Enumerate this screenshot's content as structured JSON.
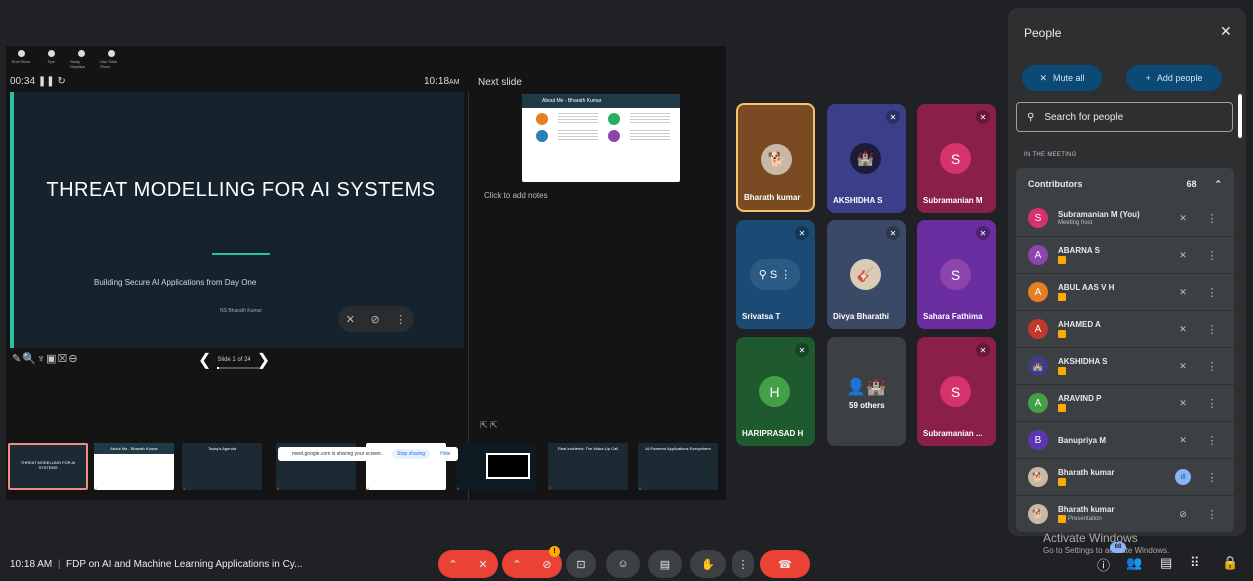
{
  "presenter": {
    "toolbar": [
      "End Show",
      "Tips",
      "Swap Displays",
      "Use Slide Show"
    ],
    "timer": "00:34",
    "clock": "10:18",
    "clock_ampm": "AM",
    "next_slide_label": "Next slide",
    "add_notes": "Click to add notes",
    "slide_counter": "Slide 1 of 24",
    "progress": 0.04
  },
  "current_slide": {
    "title": "THREAT MODELLING FOR AI SYSTEMS",
    "subtitle": "Building Secure AI Applications from Day One",
    "author": "NS Bharath Kumar"
  },
  "next_slide": {
    "title": "About Me - Bharath Kumar"
  },
  "thumbnails": [
    {
      "num": "1",
      "title": "THREAT MODELLING FOR AI SYSTEMS"
    },
    {
      "num": "2",
      "title": "About Me - Bharath Kumar"
    },
    {
      "num": "3",
      "title": "Today's Agenda"
    },
    {
      "num": "4",
      "title": ""
    },
    {
      "num": "5",
      "title": ""
    },
    {
      "num": "6",
      "title": ""
    },
    {
      "num": "7",
      "title": "Real Incidents: The Wake-Up Call"
    },
    {
      "num": "8",
      "title": "AI-Powered Applications Everywhere"
    }
  ],
  "share_banner": {
    "text": "meet.google.com is sharing your screen.",
    "stop": "Stop sharing",
    "hide": "Hide"
  },
  "tiles": [
    {
      "name": "Bharath kumar",
      "initial": "",
      "color": "#7a4a22"
    },
    {
      "name": "AKSHIDHA S",
      "initial": "",
      "color": "#3b3f8a"
    },
    {
      "name": "Subramanian M",
      "initial": "S",
      "color": "#8a1f4a"
    },
    {
      "name": "Srivatsa T",
      "initial": "",
      "color": "#1b4a74"
    },
    {
      "name": "Divya Bharathi",
      "initial": "",
      "color": "#3a4a66"
    },
    {
      "name": "Sahara Fathima",
      "initial": "S",
      "color": "#6a2ea0"
    },
    {
      "name": "HARIPRASAD H",
      "initial": "H",
      "color": "#1f5a2e"
    },
    {
      "name": "59 others",
      "initial": "",
      "color": "#3c4043"
    },
    {
      "name": "Subramanian ...",
      "initial": "S",
      "color": "#8a1f4a"
    }
  ],
  "people_panel": {
    "title": "People",
    "mute_all": "Mute all",
    "add_people": "Add people",
    "search_placeholder": "Search for people",
    "section": "IN THE MEETING",
    "group": "Contributors",
    "count": "68",
    "rows": [
      {
        "name": "Subramanian M (You)",
        "sub": "Meeting host",
        "initial": "S",
        "color": "#d6336c",
        "badge": false
      },
      {
        "name": "ABARNA S",
        "sub": "",
        "initial": "A",
        "color": "#8e44ad",
        "badge": true
      },
      {
        "name": "ABUL AAS V H",
        "sub": "",
        "initial": "A",
        "color": "#e67e22",
        "badge": true
      },
      {
        "name": "AHAMED A",
        "sub": "",
        "initial": "A",
        "color": "#c0392b",
        "badge": true
      },
      {
        "name": "AKSHIDHA S",
        "sub": "",
        "initial": "",
        "color": "#3b3f8a",
        "badge": true
      },
      {
        "name": "ARAVIND P",
        "sub": "",
        "initial": "A",
        "color": "#43a047",
        "badge": true
      },
      {
        "name": "Banupriya M",
        "sub": "",
        "initial": "B",
        "color": "#5e35b1",
        "badge": false
      },
      {
        "name": "Bharath kumar",
        "sub": "",
        "initial": "",
        "color": "#7a4a22",
        "badge": true
      },
      {
        "name": "Bharath kumar",
        "sub": "Presentation",
        "initial": "",
        "color": "#7a4a22",
        "badge": true
      }
    ]
  },
  "bottom": {
    "time": "10:18 AM",
    "separator": "|",
    "meeting_title": "FDP on AI and Machine Learning Applications in Cy...",
    "camera_badge": "!",
    "people_count": "68"
  },
  "watermark": {
    "line1": "Activate Windows",
    "line2": "Go to Settings to activate Windows."
  }
}
